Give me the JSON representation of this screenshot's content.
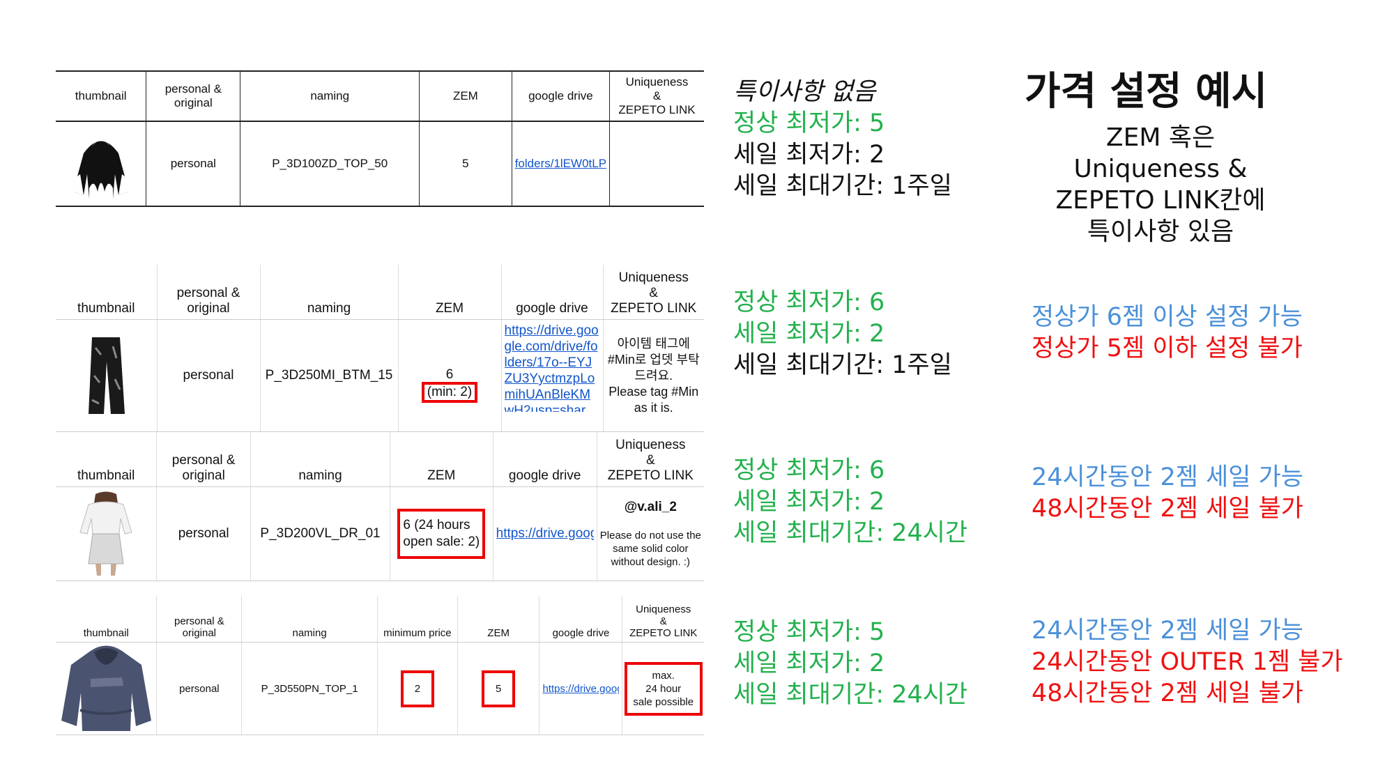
{
  "title": "가격 설정 예시",
  "explanation": [
    "ZEM 혹은",
    "Uniqueness &",
    "ZEPETO LINK칸에",
    "특이사항 있음"
  ],
  "headers": {
    "thumbnail": "thumbnail",
    "personal_line1": "personal &",
    "personal_line2": "original",
    "naming": "naming",
    "min_price": "minimum price",
    "zem": "ZEM",
    "drive": "google drive",
    "uniq_line1": "Uniqueness",
    "uniq_line2": "&",
    "uniq_line3": "ZEPETO LINK"
  },
  "row1": {
    "type": "personal",
    "naming": "P_3D100ZD_TOP_50",
    "zem": "5",
    "drive": "folders/1lEW0tLP"
  },
  "row2": {
    "type": "personal",
    "naming": "P_3D250MI_BTM_15",
    "zem": "6",
    "zem_min": "(min: 2)",
    "drive": "https://drive.google.com/drive/folders/17o--EYJZU3YyctmzpLomihUAnBleKMwH2usp=shar",
    "uniq_ko": "아이템 태그에 #Min로 업뎃 부탁드려요.",
    "uniq_en": "Please tag #Min as it is."
  },
  "row3": {
    "type": "personal",
    "naming": "P_3D200VL_DR_01",
    "zem_line1": "6 (24 hours",
    "zem_line2": "open sale: 2)",
    "drive": "https://drive.goog",
    "uniq_handle": "@v.ali_2",
    "uniq_note": "Please do not use the same solid color without design. :)"
  },
  "row4": {
    "type": "personal",
    "naming": "P_3D550PN_TOP_1",
    "min_price": "2",
    "zem": "5",
    "drive": "https://drive.goog",
    "uniq_line1": "max.",
    "uniq_line2": "24 hour",
    "uniq_line3": "sale possible"
  },
  "block1": {
    "line1": "특이사항 없음",
    "line2": "정상 최저가: 5",
    "line3": "세일 최저가: 2",
    "line4": "세일 최대기간: 1주일"
  },
  "block2": {
    "line1": "정상 최저가: 6",
    "line2": "세일 최저가: 2",
    "line3": "세일 최대기간: 1주일"
  },
  "block3": {
    "line1": "정상 최저가: 6",
    "line2": "세일 최저가: 2",
    "line3": "세일 최대기간: 24시간"
  },
  "block4": {
    "line1": "정상 최저가: 5",
    "line2": "세일 최저가: 2",
    "line3": "세일 최대기간: 24시간"
  },
  "result2": {
    "ok": "정상가 6젬 이상 설정 가능",
    "ng": "정상가 5젬 이하 설정 불가"
  },
  "result3": {
    "ok": "24시간동안 2젬 세일 가능",
    "ng": "48시간동안 2젬 세일 불가"
  },
  "result4": {
    "ok": "24시간동안 2젬 세일 가능",
    "ng1": "24시간동안 OUTER 1젬 불가",
    "ng2": "48시간동안 2젬 세일 불가"
  },
  "colors": {
    "green": "#22b14c",
    "blue": "#4a90d9",
    "red": "#f01010",
    "link": "#1155cc",
    "box": "#e00000"
  }
}
